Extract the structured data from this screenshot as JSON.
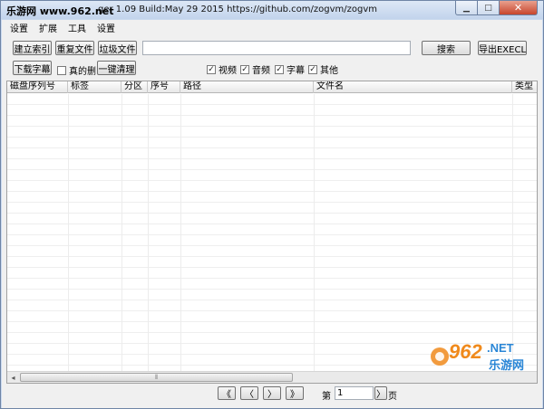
{
  "titlebar": {
    "site_watermark": "乐游网 www.962.net",
    "title": "ger 1.09 Build:May 29 2015  https://github.com/zogvm/zogvm",
    "min_icon": "minimize-icon",
    "max_icon": "maximize-icon",
    "close_icon": "close-icon",
    "min_glyph": "▁",
    "max_glyph": "□",
    "close_glyph": "✕"
  },
  "menu": [
    "设置",
    "扩展",
    "工具",
    "设置"
  ],
  "toolbar": {
    "build_index": "建立索引",
    "duplicate_files": "重复文件",
    "junk_files": "垃圾文件",
    "search_value": "",
    "search_button": "搜索",
    "export_button": "导出EXECL",
    "download_subtitles": "下载字幕",
    "real_delete": {
      "label": "真的删",
      "checked": false
    },
    "one_click_clean": "一键清理",
    "filters": [
      {
        "label": "视频",
        "checked": true
      },
      {
        "label": "音频",
        "checked": true
      },
      {
        "label": "字幕",
        "checked": true
      },
      {
        "label": "其他",
        "checked": true
      }
    ]
  },
  "table": {
    "columns": [
      "磁盘序列号",
      "标签",
      "分区",
      "序号",
      "路径",
      "文件名",
      "类型"
    ],
    "rows": []
  },
  "scrollbar": {
    "left_arrow": "◂",
    "grip": "⦀"
  },
  "pager": {
    "first": "《",
    "prev": "〈",
    "next": "〉",
    "last": "》",
    "label_prefix": "第",
    "page_value": "1",
    "page_go": "〉",
    "label_suffix": "页"
  },
  "watermark": {
    "brand_number": "962",
    "brand_suffix": ".NET",
    "brand_cn": "乐游网",
    "colors": {
      "orange": "#f08a1c",
      "blue": "#2a86d6"
    }
  }
}
